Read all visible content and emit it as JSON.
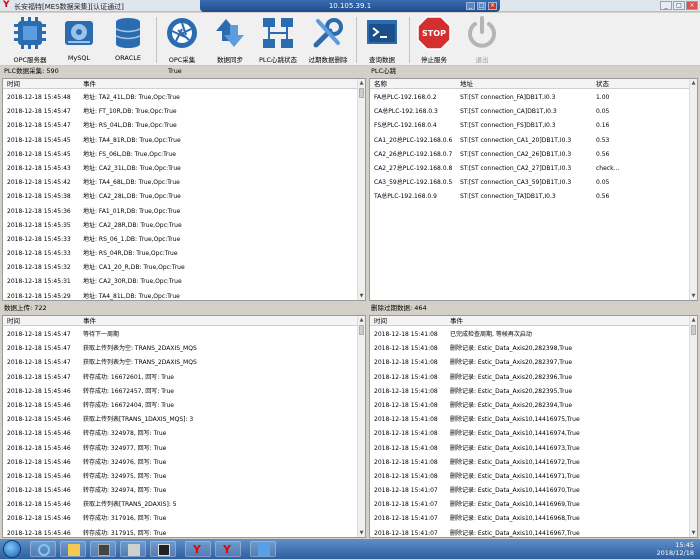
{
  "window": {
    "title": "长安福特[MES数据采集][认证通过]"
  },
  "remote": {
    "host": "10.105.39.1"
  },
  "toolbar": [
    {
      "label": "OPC服务器",
      "icon": "opc-server-icon"
    },
    {
      "label": "MySQL",
      "icon": "mysql-icon"
    },
    {
      "label": "ORACLE",
      "icon": "oracle-icon"
    },
    {
      "label": "OPC采集",
      "icon": "camera-shutter-icon"
    },
    {
      "label": "数据同步",
      "icon": "sync-arrows-icon"
    },
    {
      "label": "PLC心跳状态",
      "icon": "network-icon"
    },
    {
      "label": "过期数据删除",
      "icon": "tools-icon"
    },
    {
      "label": "查询数据",
      "icon": "console-icon"
    },
    {
      "label": "停止服务",
      "icon": "stop-sign-icon"
    },
    {
      "label": "退出",
      "icon": "power-icon"
    }
  ],
  "stop_sign_text": "STOP",
  "status": {
    "plc_collect": "PLC数据采集: 590",
    "collect_flag": "True",
    "plc_heartbeat": "PLC心跳",
    "upload": "数据上传: 722",
    "delete_expired": "删除过期数据: 464"
  },
  "plc_collect_panel": {
    "columns": [
      "时间",
      "事件"
    ],
    "rows": [
      [
        "2018-12-18 15:45:48",
        "地址: TA2_41L,DB: True,Opc:True"
      ],
      [
        "2018-12-18 15:45:47",
        "地址: FT_10R,DB: True,Opc:True"
      ],
      [
        "2018-12-18 15:45:47",
        "地址: RS_04L,DB: True,Opc:True"
      ],
      [
        "2018-12-18 15:45:45",
        "地址: TA4_81R,DB: True,Opc:True"
      ],
      [
        "2018-12-18 15:45:45",
        "地址: FS_06L,DB: True,Opc:True"
      ],
      [
        "2018-12-18 15:45:43",
        "地址: CA2_31L,DB: True,Opc:True"
      ],
      [
        "2018-12-18 15:45:42",
        "地址: TA4_68L,DB: True,Opc:True"
      ],
      [
        "2018-12-18 15:45:38",
        "地址: CA2_28L,DB: True,Opc:True"
      ],
      [
        "2018-12-18 15:45:36",
        "地址: FA1_01R,DB: True,Opc:True"
      ],
      [
        "2018-12-18 15:45:35",
        "地址: CA2_28R,DB: True,Opc:True"
      ],
      [
        "2018-12-18 15:45:33",
        "地址: RS_06_1,DB: True,Opc:True"
      ],
      [
        "2018-12-18 15:45:33",
        "地址: RS_04R,DB: True,Opc:True"
      ],
      [
        "2018-12-18 15:45:32",
        "地址: CA1_20_R,DB: True,Opc:True"
      ],
      [
        "2018-12-18 15:45:31",
        "地址: CA2_30R,DB: True,Opc:True"
      ],
      [
        "2018-12-18 15:45:29",
        "地址: TA4_81L,DB: True,Opc:True"
      ]
    ]
  },
  "plc_heartbeat_panel": {
    "columns": [
      "名称",
      "地址",
      "状态"
    ],
    "rows": [
      [
        "FA总PLC-192.168.0.2",
        "ST:[ST connection_FA]DB1T,I0.3",
        "1.00"
      ],
      [
        "CA总PLC-192.168.0.3",
        "ST:[ST connection_CA]DB1T,I0.3",
        "0.05"
      ],
      [
        "FS总PLC-192.168.0.4",
        "ST:[ST connection_FS]DB1T,I0.3",
        "0.16"
      ],
      [
        "CA1_20总PLC-192.168.0.6",
        "ST:[ST connection_CA1_20]DB1T,I0.3",
        "0.53"
      ],
      [
        "CA2_26总PLC-192.168.0.7",
        "ST:[ST connection_CA2_26]DB1T,I0.3",
        "0.56"
      ],
      [
        "CA2_27总PLC-192.168.0.8",
        "ST:[ST connection_CA2_27]DB1T,I0.3",
        "check..."
      ],
      [
        "CA3_59总PLC-192.168.0.5",
        "ST:[ST connection_CA3_59]DB1T,I0.3",
        "0.05"
      ],
      [
        "TA总PLC-192.168.0.9",
        "ST:[ST connection_TA]DB1T,I0.3",
        "0.56"
      ]
    ]
  },
  "upload_panel": {
    "columns": [
      "时间",
      "事件"
    ],
    "rows": [
      [
        "2018-12-18 15:45:47",
        "等待下一周期"
      ],
      [
        "2018-12-18 15:45:47",
        "获取上传列表为空: TRANS_2DAXIS_MQS"
      ],
      [
        "2018-12-18 15:45:47",
        "获取上传列表为空: TRANS_2DAXIS_MQS"
      ],
      [
        "2018-12-18 15:45:47",
        "转存成功: 16672601, 回写: True"
      ],
      [
        "2018-12-18 15:45:46",
        "转存成功: 16672457, 回写: True"
      ],
      [
        "2018-12-18 15:45:46",
        "转存成功: 16672404, 回写: True"
      ],
      [
        "2018-12-18 15:45:46",
        "获取上传列表[TRANS_1DAXIS_MQS]: 3"
      ],
      [
        "2018-12-18 15:45:46",
        "转存成功: 324978, 回写: True"
      ],
      [
        "2018-12-18 15:45:46",
        "转存成功: 324977, 回写: True"
      ],
      [
        "2018-12-18 15:45:46",
        "转存成功: 324976, 回写: True"
      ],
      [
        "2018-12-18 15:45:46",
        "转存成功: 324975, 回写: True"
      ],
      [
        "2018-12-18 15:45:46",
        "转存成功: 324974, 回写: True"
      ],
      [
        "2018-12-18 15:45:46",
        "获取上传列表[TRANS_2DAXIS]: 5"
      ],
      [
        "2018-12-18 15:45:46",
        "转存成功: 317916, 回写: True"
      ],
      [
        "2018-12-18 15:45:46",
        "转存成功: 317915, 回写: True"
      ]
    ]
  },
  "delete_panel": {
    "columns": [
      "时间",
      "事件"
    ],
    "rows": [
      [
        "2018-12-18 15:41:08",
        "已完成检查周期, 等候再次启动"
      ],
      [
        "2018-12-18 15:41:08",
        "删除记录: Estic_Data_Axis20,282398,True"
      ],
      [
        "2018-12-18 15:41:08",
        "删除记录: Estic_Data_Axis20,282397,True"
      ],
      [
        "2018-12-18 15:41:08",
        "删除记录: Estic_Data_Axis20,282396,True"
      ],
      [
        "2018-12-18 15:41:08",
        "删除记录: Estic_Data_Axis20,282395,True"
      ],
      [
        "2018-12-18 15:41:08",
        "删除记录: Estic_Data_Axis20,282394,True"
      ],
      [
        "2018-12-18 15:41:08",
        "删除记录: Estic_Data_Axis10,14416975,True"
      ],
      [
        "2018-12-18 15:41:08",
        "删除记录: Estic_Data_Axis10,14416974,True"
      ],
      [
        "2018-12-18 15:41:08",
        "删除记录: Estic_Data_Axis10,14416973,True"
      ],
      [
        "2018-12-18 15:41:08",
        "删除记录: Estic_Data_Axis10,14416972,True"
      ],
      [
        "2018-12-18 15:41:08",
        "删除记录: Estic_Data_Axis10,14416971,True"
      ],
      [
        "2018-12-18 15:41:07",
        "删除记录: Estic_Data_Axis10,14416970,True"
      ],
      [
        "2018-12-18 15:41:07",
        "删除记录: Estic_Data_Axis10,14416969,True"
      ],
      [
        "2018-12-18 15:41:07",
        "删除记录: Estic_Data_Axis10,14416968,True"
      ],
      [
        "2018-12-18 15:41:07",
        "删除记录: Estic_Data_Axis10,14416967,True"
      ]
    ]
  },
  "taskbar": {
    "items": [
      "ie-icon",
      "explorer-icon",
      "media-icon",
      "tool-icon",
      "terminal-icon",
      "app-y-icon",
      "app-y-icon-2",
      "remote-desktop-icon"
    ],
    "time": "15:45",
    "date": "2018/12/18"
  },
  "colors": {
    "accent": "#2f5f9f",
    "toolbar_blue": "#2b6cb0",
    "stop_red": "#d32f2f",
    "app_red": "#d00000"
  }
}
